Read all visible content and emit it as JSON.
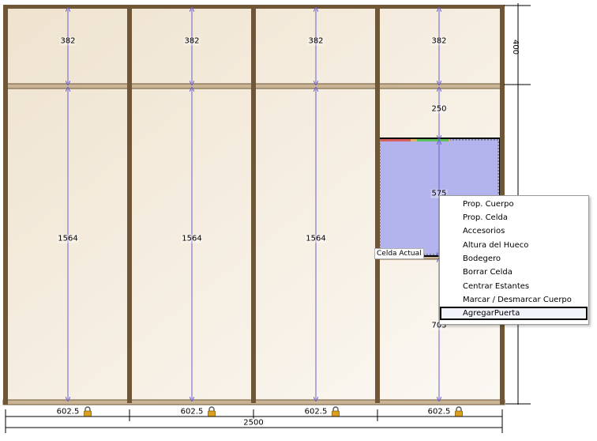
{
  "dimensions": {
    "top_heights": [
      "382",
      "382",
      "382",
      "382"
    ],
    "tall_heights": [
      "1564",
      "1564",
      "1564"
    ],
    "col4_mid_height": "250",
    "col4_selected_height": "575",
    "col4_lower_height": "703",
    "right_top_height": "400",
    "column_widths": [
      "602.5",
      "602.5",
      "602.5",
      "602.5"
    ],
    "total_width": "2500"
  },
  "selected_cell_label": "Celda Actual",
  "context_menu": {
    "items": [
      "Prop. Cuerpo",
      "Prop. Celda",
      "Accesorios",
      "Altura del Hueco",
      "Bodegero",
      "Borrar Celda",
      "Centrar Estantes",
      "Marcar / Desmarcar Cuerpo",
      "AgregarPuerta"
    ],
    "highlighted": "AgregarPuerta"
  },
  "colors": {
    "frame": "#6e5636",
    "panel": "#f5ede0",
    "dimension_line": "#6a5fd0",
    "selected_cell": "#b3b3ee"
  },
  "icons": [
    "lock-icon"
  ]
}
